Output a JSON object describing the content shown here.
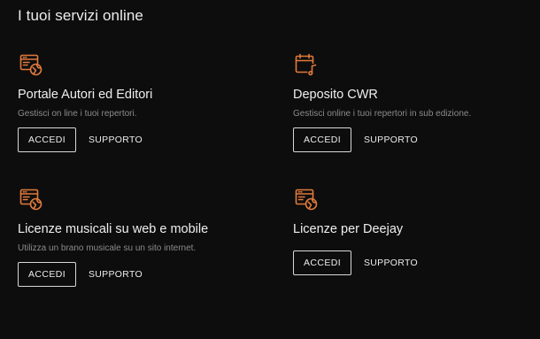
{
  "section": {
    "title": "I tuoi servizi online"
  },
  "accent_color": "#e07a3c",
  "services": [
    {
      "icon": "browser-globe-icon",
      "title": "Portale Autori ed Editori",
      "description": "Gestisci on line i tuoi repertori.",
      "primary_label": "ACCEDI",
      "secondary_label": "SUPPORTO"
    },
    {
      "icon": "calendar-music-icon",
      "title": "Deposito CWR",
      "description": "Gestisci online i tuoi repertori in sub edizione.",
      "primary_label": "ACCEDI",
      "secondary_label": "SUPPORTO"
    },
    {
      "icon": "browser-globe-icon",
      "title": "Licenze musicali su web e mobile",
      "description": "Utilizza un brano musicale su un sito internet.",
      "primary_label": "ACCEDI",
      "secondary_label": "SUPPORTO"
    },
    {
      "icon": "browser-globe-icon",
      "title": "Licenze per Deejay",
      "description": "",
      "primary_label": "ACCEDI",
      "secondary_label": "SUPPORTO"
    }
  ]
}
